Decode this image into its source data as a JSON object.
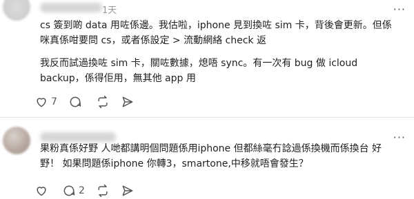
{
  "post1": {
    "time": "1天",
    "text1": "cs 簽到啲 data 用咗係邊。我估啦，iphone 見到換咗 sim 卡，背後會更新。但係\n咪真係咁要問 cs，或者係設定 > 流動網絡 check 返",
    "text2": "我反而試過換咗 sim 卡，關咗數據，熄唔 sync。有一次有 bug 做 icloud\nbackup，係得佢用，無其他 app 用",
    "likes": "7",
    "replies": ""
  },
  "post2": {
    "text": "果粉真係好野 人哋都講明個問題係用iphone 但都絲毫冇諗過係換機而係換台 好\n野！ 如果問題係iphone 你轉3，smartone,中移就唔會發生？",
    "likes": "",
    "replies": "2"
  },
  "icons": {
    "more": "more-icon",
    "like": "heart-icon",
    "reply": "comment-icon",
    "repost": "repost-icon",
    "share": "send-icon"
  }
}
